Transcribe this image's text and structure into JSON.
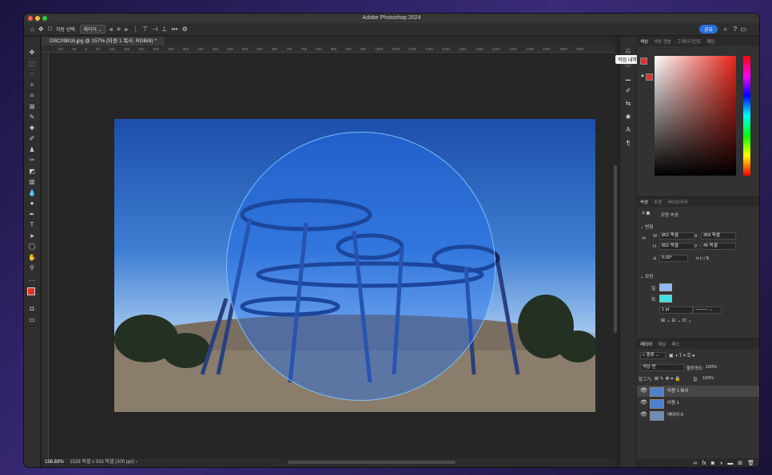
{
  "window": {
    "title": "Adobe Photoshop 2024"
  },
  "options_bar": {
    "auto_select_label": "자동 선택:",
    "auto_select_value": "레이어",
    "more": "•••",
    "share_label": "공유"
  },
  "document": {
    "tab_label": "DSC09818.jpg @ 157% (타원 1 복사, RGB/8) *"
  },
  "ruler_ticks": [
    "100",
    "50",
    "0",
    "50",
    "100",
    "150",
    "200",
    "250",
    "300",
    "350",
    "400",
    "450",
    "500",
    "550",
    "600",
    "650",
    "700",
    "750",
    "800",
    "850",
    "900",
    "950",
    "1000",
    "1050",
    "1100",
    "1150",
    "1200",
    "1250",
    "1300",
    "1350",
    "1400",
    "1450",
    "1500",
    "1550",
    "1600"
  ],
  "status": {
    "zoom": "156.83%",
    "info": "1528 픽셀 x 933 픽셀 (300 ppi)",
    "arrow": "›"
  },
  "tooltip": "작업 내역",
  "color_panel": {
    "tabs": [
      "색상",
      "색상 견본",
      "그레이디언트",
      "패턴"
    ],
    "foreground": "#e3302a",
    "background": "#000000",
    "base_hue": "#e82418"
  },
  "properties_panel": {
    "tabs": [
      "속성",
      "조정",
      "라이브러리"
    ],
    "shape_props": "모양 속성",
    "transform_title": "변형",
    "w_label": "W",
    "w_value": "852 픽셀",
    "h_label": "H",
    "h_value": "852 픽셀",
    "x_label": "X",
    "x_value": "359 픽셀",
    "y_label": "Y",
    "y_value": "45 픽셀",
    "angle": "0.00°",
    "appearance_title": "모양",
    "fill_label": "칠",
    "stroke_label": "획",
    "fill_color": "#8fbaf3",
    "stroke_color": "#3fe0e0",
    "stroke_width": "1 pt"
  },
  "layers_panel": {
    "tabs": [
      "레이어",
      "채널",
      "패스"
    ],
    "kind": "종류",
    "blend_mode": "색상 번",
    "opacity_label": "불투명도:",
    "opacity_value": "100%",
    "lock_label": "잠그기:",
    "fill_label": "칠:",
    "fill_value": "100%",
    "layers": [
      {
        "name": "타원 1 복사",
        "active": true
      },
      {
        "name": "타원 1",
        "active": false
      },
      {
        "name": "레이어 0",
        "active": false
      }
    ]
  }
}
